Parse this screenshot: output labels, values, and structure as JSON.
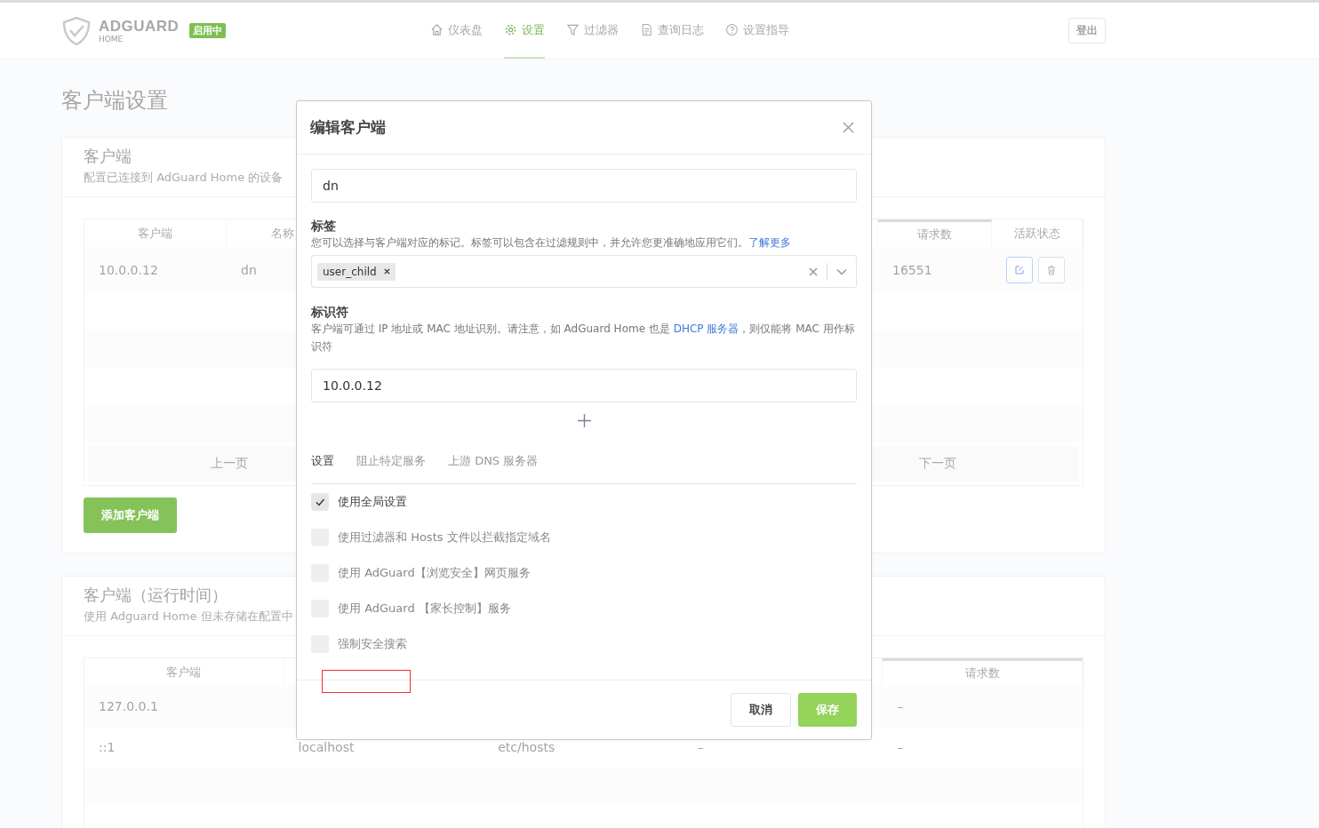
{
  "header": {
    "logo": {
      "name": "ADGUARD",
      "sub": "HOME"
    },
    "status_badge": "启用中",
    "nav": [
      {
        "label": "仪表盘",
        "kind": "home",
        "selected": false
      },
      {
        "label": "设置",
        "kind": "gear",
        "selected": true
      },
      {
        "label": "过滤器",
        "kind": "filter",
        "selected": false
      },
      {
        "label": "查询日志",
        "kind": "document",
        "selected": false
      },
      {
        "label": "设置指导",
        "kind": "help",
        "selected": false
      }
    ],
    "logout": "登出"
  },
  "page_title": "客户端设置",
  "clients_card": {
    "title": "客户端",
    "subtitle": "配置已连接到 AdGuard Home 的设备",
    "columns": [
      "客户端",
      "名称",
      "请求数",
      "活跃状态"
    ],
    "rows": [
      {
        "client": "10.0.0.12",
        "name": "dn",
        "requests": "16551"
      }
    ],
    "pagination": {
      "prev": "上一页",
      "next": "下一页"
    },
    "add_button": "添加客户端"
  },
  "runtime_card": {
    "title": "客户端（运行时间）",
    "subtitle": "使用 Adguard Home 但未存储在配置中",
    "columns": [
      "客户端",
      "请求数"
    ],
    "rows": [
      {
        "cells": [
          "127.0.0.1",
          "",
          "",
          "",
          "–"
        ]
      },
      {
        "cells": [
          "::1",
          "localhost",
          "etc/hosts",
          "–",
          "–"
        ]
      }
    ]
  },
  "modal": {
    "title": "编辑客户端",
    "name_value": "dn",
    "tags_label": "标签",
    "tags_help": "您可以选择与客户端对应的标记。标签可以包含在过滤规则中，并允许您更准确地应用它们。",
    "tags_link": "了解更多",
    "tags": [
      "user_child"
    ],
    "ids_label": "标识符",
    "ids_help_before": "客户端可通过 IP 地址或 MAC 地址识别。请注意，如 AdGuard Home 也是 ",
    "ids_link": "DHCP 服务器",
    "ids_help_after": "，则仅能将 MAC 用作标识符",
    "ids": [
      "10.0.0.12"
    ],
    "tabs": [
      {
        "label": "设置",
        "selected": true
      },
      {
        "label": "阻止特定服务",
        "selected": false
      },
      {
        "label": "上游 DNS 服务器",
        "selected": false
      }
    ],
    "options": [
      {
        "label": "使用全局设置",
        "checked": true,
        "disabled": false
      },
      {
        "label": "使用过滤器和 Hosts 文件以拦截指定域名",
        "checked": false,
        "disabled": true
      },
      {
        "label": "使用 AdGuard【浏览安全】网页服务",
        "checked": false,
        "disabled": true
      },
      {
        "label": "使用 AdGuard 【家长控制】服务",
        "checked": false,
        "disabled": true
      },
      {
        "label": "强制安全搜索",
        "checked": false,
        "disabled": true
      }
    ],
    "cancel": "取消",
    "save": "保存"
  }
}
